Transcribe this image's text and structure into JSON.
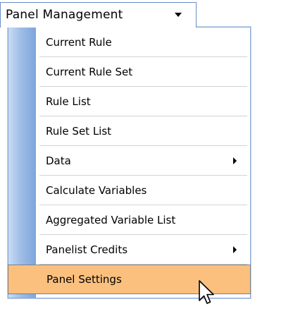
{
  "menu": {
    "title": "Panel Management",
    "caret_icon": "caret-down-icon",
    "items": [
      {
        "label": "Current Rule",
        "submenu": false,
        "highlighted": false
      },
      {
        "label": "Current Rule Set",
        "submenu": false,
        "highlighted": false
      },
      {
        "label": "Rule List",
        "submenu": false,
        "highlighted": false
      },
      {
        "label": "Rule Set List",
        "submenu": false,
        "highlighted": false
      },
      {
        "label": "Data",
        "submenu": true,
        "highlighted": false
      },
      {
        "label": "Calculate Variables",
        "submenu": false,
        "highlighted": false
      },
      {
        "label": "Aggregated Variable List",
        "submenu": false,
        "highlighted": false
      },
      {
        "label": "Panelist Credits",
        "submenu": true,
        "highlighted": false
      },
      {
        "label": "Panel Settings",
        "submenu": false,
        "highlighted": true
      }
    ]
  },
  "colors": {
    "highlight": "#fbc07e",
    "gutter_dark": "#7ea6dc",
    "gutter_light": "#c9dcf4",
    "border": "#6a8cc8"
  },
  "cursor": {
    "icon": "arrow-cursor-icon"
  }
}
